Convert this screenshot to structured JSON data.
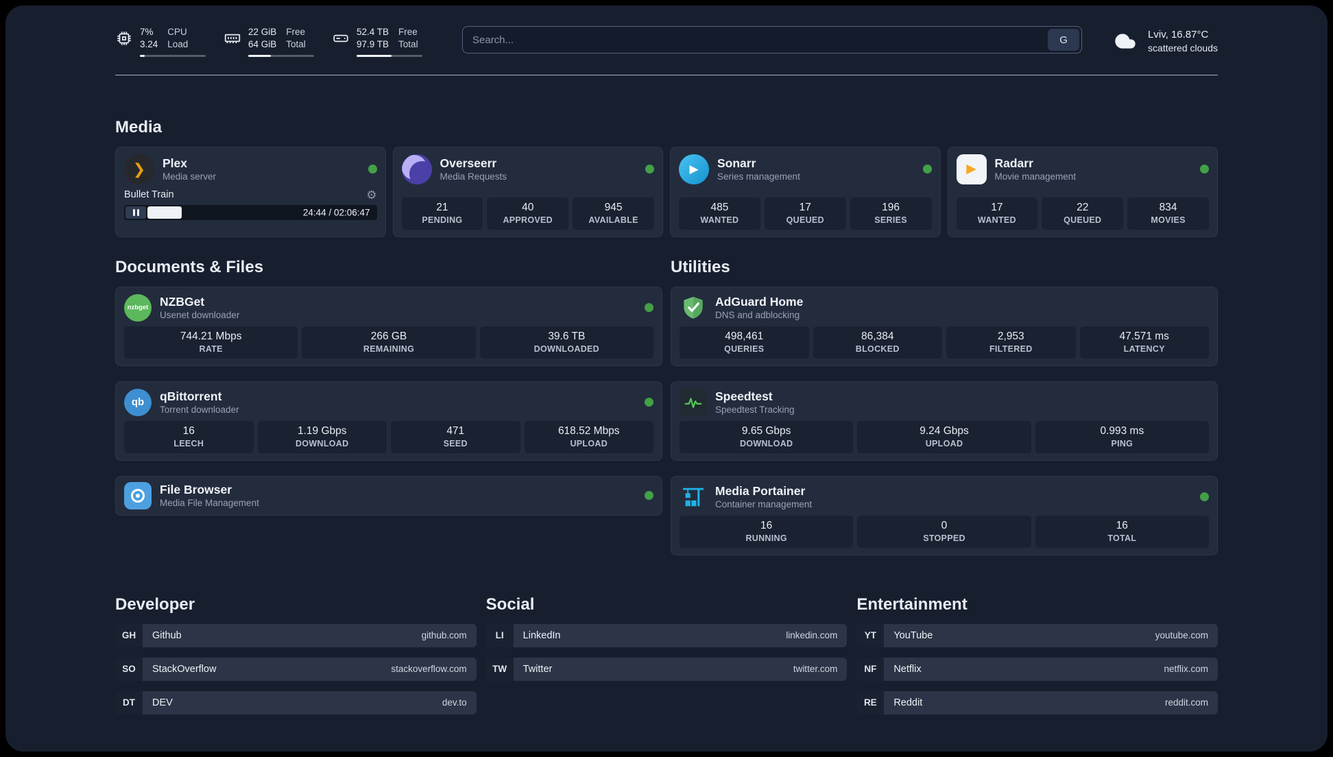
{
  "colors": {
    "status_online": "#43a047"
  },
  "icons": {
    "plex_glyph": "❯",
    "sonarr_glyph": "▶",
    "radarr_glyph": "▶",
    "nzbget_text": "nzbget",
    "qbittorrent_text": "qb",
    "gear_glyph": "⚙"
  },
  "topbar": {
    "cpu": {
      "value": "7%",
      "load": "3.24",
      "label_top": "CPU",
      "label_bottom": "Load",
      "bar_percent": 7
    },
    "memory": {
      "free": "22 GiB",
      "total": "64 GiB",
      "label_top": "Free",
      "label_bottom": "Total",
      "bar_percent": 34
    },
    "storage": {
      "free": "52.4 TB",
      "total": "97.9 TB",
      "label_top": "Free",
      "label_bottom": "Total",
      "bar_percent": 53
    },
    "search": {
      "placeholder": "Search...",
      "engine_label": "G"
    },
    "weather": {
      "location": "Lviv, 16.87°C",
      "condition": "scattered clouds"
    }
  },
  "media": {
    "title": "Media",
    "plex": {
      "name": "Plex",
      "subtitle": "Media server",
      "now_playing": "Bullet Train",
      "time": "24:44 / 02:06:47",
      "progress_percent": 15
    },
    "overseerr": {
      "name": "Overseerr",
      "subtitle": "Media Requests",
      "stats": [
        {
          "value": "21",
          "label": "PENDING"
        },
        {
          "value": "40",
          "label": "APPROVED"
        },
        {
          "value": "945",
          "label": "AVAILABLE"
        }
      ]
    },
    "sonarr": {
      "name": "Sonarr",
      "subtitle": "Series management",
      "stats": [
        {
          "value": "485",
          "label": "WANTED"
        },
        {
          "value": "17",
          "label": "QUEUED"
        },
        {
          "value": "196",
          "label": "SERIES"
        }
      ]
    },
    "radarr": {
      "name": "Radarr",
      "subtitle": "Movie management",
      "stats": [
        {
          "value": "17",
          "label": "WANTED"
        },
        {
          "value": "22",
          "label": "QUEUED"
        },
        {
          "value": "834",
          "label": "MOVIES"
        }
      ]
    }
  },
  "documents": {
    "title": "Documents & Files",
    "nzbget": {
      "name": "NZBGet",
      "subtitle": "Usenet downloader",
      "stats": [
        {
          "value": "744.21 Mbps",
          "label": "RATE"
        },
        {
          "value": "266 GB",
          "label": "REMAINING"
        },
        {
          "value": "39.6 TB",
          "label": "DOWNLOADED"
        }
      ]
    },
    "qbittorrent": {
      "name": "qBittorrent",
      "subtitle": "Torrent downloader",
      "stats": [
        {
          "value": "16",
          "label": "LEECH"
        },
        {
          "value": "1.19 Gbps",
          "label": "DOWNLOAD"
        },
        {
          "value": "471",
          "label": "SEED"
        },
        {
          "value": "618.52 Mbps",
          "label": "UPLOAD"
        }
      ]
    },
    "filebrowser": {
      "name": "File Browser",
      "subtitle": "Media File Management"
    }
  },
  "utilities": {
    "title": "Utilities",
    "adguard": {
      "name": "AdGuard Home",
      "subtitle": "DNS and adblocking",
      "stats": [
        {
          "value": "498,461",
          "label": "QUERIES"
        },
        {
          "value": "86,384",
          "label": "BLOCKED"
        },
        {
          "value": "2,953",
          "label": "FILTERED"
        },
        {
          "value": "47.571 ms",
          "label": "LATENCY"
        }
      ]
    },
    "speedtest": {
      "name": "Speedtest",
      "subtitle": "Speedtest Tracking",
      "stats": [
        {
          "value": "9.65 Gbps",
          "label": "DOWNLOAD"
        },
        {
          "value": "9.24 Gbps",
          "label": "UPLOAD"
        },
        {
          "value": "0.993 ms",
          "label": "PING"
        }
      ]
    },
    "portainer": {
      "name": "Media Portainer",
      "subtitle": "Container management",
      "stats": [
        {
          "value": "16",
          "label": "RUNNING"
        },
        {
          "value": "0",
          "label": "STOPPED"
        },
        {
          "value": "16",
          "label": "TOTAL"
        }
      ]
    }
  },
  "bookmarks": {
    "developer": {
      "title": "Developer",
      "items": [
        {
          "abbr": "GH",
          "name": "Github",
          "url": "github.com"
        },
        {
          "abbr": "SO",
          "name": "StackOverflow",
          "url": "stackoverflow.com"
        },
        {
          "abbr": "DT",
          "name": "DEV",
          "url": "dev.to"
        }
      ]
    },
    "social": {
      "title": "Social",
      "items": [
        {
          "abbr": "LI",
          "name": "LinkedIn",
          "url": "linkedin.com"
        },
        {
          "abbr": "TW",
          "name": "Twitter",
          "url": "twitter.com"
        }
      ]
    },
    "entertainment": {
      "title": "Entertainment",
      "items": [
        {
          "abbr": "YT",
          "name": "YouTube",
          "url": "youtube.com"
        },
        {
          "abbr": "NF",
          "name": "Netflix",
          "url": "netflix.com"
        },
        {
          "abbr": "RE",
          "name": "Reddit",
          "url": "reddit.com"
        }
      ]
    }
  }
}
